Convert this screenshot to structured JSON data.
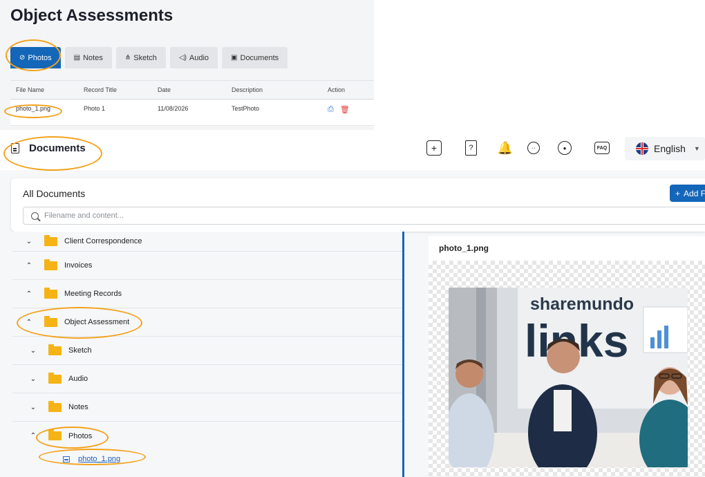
{
  "object_assessments": {
    "title": "Object Assessments",
    "tabs": [
      {
        "label": "Photos",
        "icon": "photo-icon",
        "active": true
      },
      {
        "label": "Notes",
        "icon": "note-icon"
      },
      {
        "label": "Sketch",
        "icon": "sketch-icon"
      },
      {
        "label": "Audio",
        "icon": "audio-icon"
      },
      {
        "label": "Documents",
        "icon": "document-icon"
      }
    ],
    "table": {
      "headers": [
        "File Name",
        "Record Title",
        "Date",
        "Description",
        "Action"
      ],
      "rows": [
        {
          "file_name": "photo_1.png",
          "record_title": "Photo 1",
          "date": "11/08/2026",
          "description": "TestPhoto"
        }
      ]
    }
  },
  "header": {
    "title": "Documents",
    "language": "English",
    "icons": [
      "add-icon",
      "help-icon",
      "bell-icon",
      "chat-icon",
      "support-chat-icon",
      "faq-icon"
    ],
    "faq_label": "FAQ",
    "help_label": "?",
    "add_label": "+"
  },
  "documents": {
    "card_title": "All Documents",
    "add_button": "Add F",
    "search_placeholder": "Filename and content...",
    "tree": [
      {
        "label": "Client Correspondence",
        "state": "collapsed"
      },
      {
        "label": "Invoices",
        "state": "expanded"
      },
      {
        "label": "Meeting Records",
        "state": "expanded"
      },
      {
        "label": "Object Assessment",
        "state": "expanded"
      },
      {
        "label": "Sketch",
        "state": "collapsed"
      },
      {
        "label": "Audio",
        "state": "collapsed"
      },
      {
        "label": "Notes",
        "state": "collapsed"
      },
      {
        "label": "Photos",
        "state": "expanded"
      }
    ],
    "file": "photo_1.png"
  },
  "preview": {
    "title": "photo_1.png",
    "image_text_line1": "sharemundo",
    "image_text_line2": "links"
  },
  "colors": {
    "primary": "#1466b8",
    "highlight": "#f3a21a",
    "folder": "#f5b316",
    "delete": "#e23b3b"
  }
}
